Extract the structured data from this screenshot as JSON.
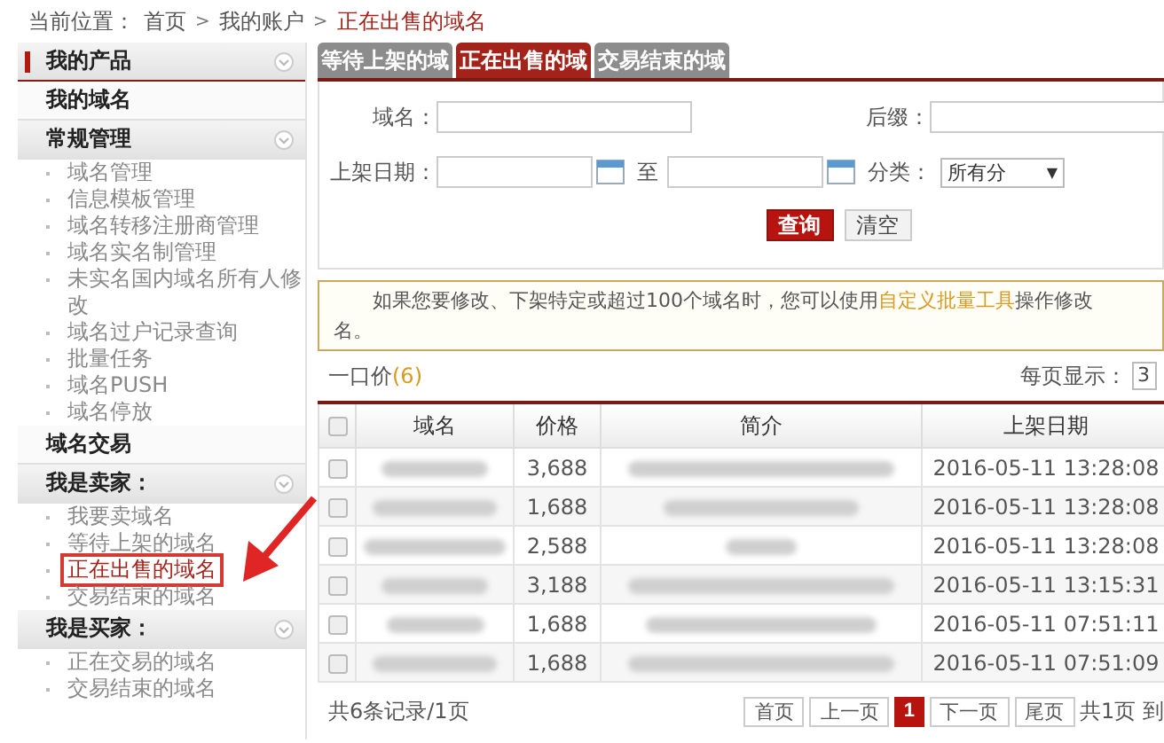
{
  "breadcrumb": {
    "label": "当前位置：",
    "separator": ">",
    "items": [
      {
        "text": "首页",
        "current": false
      },
      {
        "text": "我的账户",
        "current": false
      },
      {
        "text": "正在出售的域名",
        "current": true
      }
    ]
  },
  "sidebar": {
    "sections": [
      {
        "title": "我的产品",
        "active": true,
        "expandable": true
      },
      {
        "title": "我的域名",
        "active": false,
        "expandable": false
      },
      {
        "title": "常规管理",
        "active": false,
        "expandable": true,
        "items": [
          {
            "label": "域名管理",
            "selected": false
          },
          {
            "label": "信息模板管理",
            "selected": false
          },
          {
            "label": "域名转移注册商管理",
            "selected": false
          },
          {
            "label": "域名实名制管理",
            "selected": false
          },
          {
            "label": "未实名国内域名所有人修改",
            "selected": false
          },
          {
            "label": "域名过户记录查询",
            "selected": false
          },
          {
            "label": "批量任务",
            "selected": false
          },
          {
            "label": "域名PUSH",
            "selected": false
          },
          {
            "label": "域名停放",
            "selected": false
          }
        ]
      },
      {
        "title": "域名交易",
        "active": false,
        "expandable": false
      },
      {
        "title": "我是卖家：",
        "active": false,
        "expandable": true,
        "items": [
          {
            "label": "我要卖域名",
            "selected": false
          },
          {
            "label": "等待上架的域名",
            "selected": false
          },
          {
            "label": "正在出售的域名",
            "selected": true
          },
          {
            "label": "交易结束的域名",
            "selected": false
          }
        ]
      },
      {
        "title": "我是买家：",
        "active": false,
        "expandable": true,
        "items": [
          {
            "label": "正在交易的域名",
            "selected": false
          },
          {
            "label": "交易结束的域名",
            "selected": false
          }
        ]
      }
    ]
  },
  "tabs": [
    {
      "label": "等待上架的域",
      "selected": false
    },
    {
      "label": "正在出售的域",
      "selected": true
    },
    {
      "label": "交易结束的域",
      "selected": false
    }
  ],
  "search_form": {
    "domain_label": "域名：",
    "suffix_label": "后缀：",
    "date_label": "上架日期：",
    "date_to": "至",
    "category_label": "分类：",
    "category_value": "所有分",
    "category_caret": "▼",
    "query_button": "查询",
    "clear_button": "清空"
  },
  "notice": {
    "text_before": "如果您要修改、下架特定或超过100个域名时，您可以使用",
    "link": "自定义批量工具",
    "text_after": "操作修改",
    "line_2": "名。"
  },
  "listing": {
    "title": "一口价",
    "count": "(6)",
    "per_page_label": "每页显示：",
    "per_page_value": "3"
  },
  "table": {
    "columns": [
      "域名",
      "价格",
      "简介",
      "上架日期"
    ],
    "rows": [
      {
        "checked": false,
        "price": "3,688",
        "date": "2016-05-11 13:28:08"
      },
      {
        "checked": false,
        "price": "1,688",
        "date": "2016-05-11 13:28:08"
      },
      {
        "checked": false,
        "price": "2,588",
        "date": "2016-05-11 13:28:08"
      },
      {
        "checked": false,
        "price": "3,188",
        "date": "2016-05-11 13:15:31"
      },
      {
        "checked": false,
        "price": "1,688",
        "date": "2016-05-11 07:51:11"
      },
      {
        "checked": false,
        "price": "1,688",
        "date": "2016-05-11 07:51:09"
      }
    ]
  },
  "pagination": {
    "summary": "共6条记录/1页",
    "first": "首页",
    "prev": "上一页",
    "pages": [
      {
        "label": "1",
        "selected": true
      }
    ],
    "next": "下一页",
    "last": "尾页",
    "total": "共1页 到"
  }
}
